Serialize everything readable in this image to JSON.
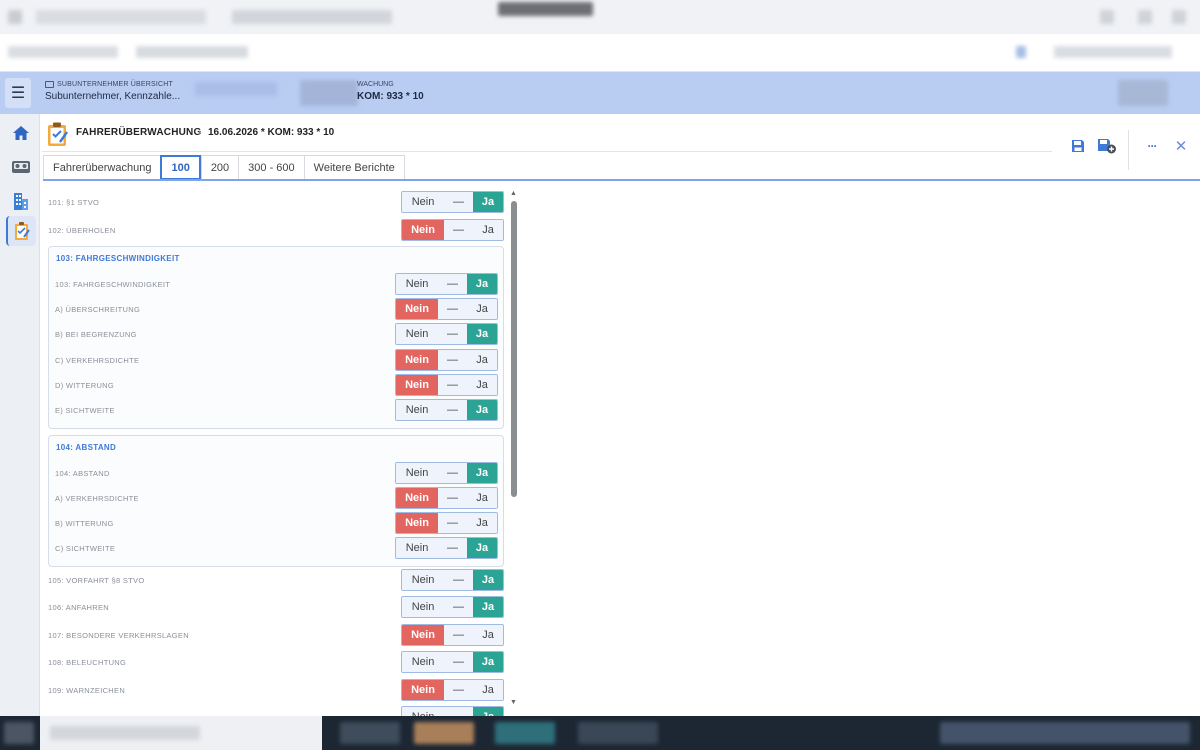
{
  "colors": {
    "nein": "#e26560",
    "ja": "#2ba496",
    "accent": "#3f7ad6",
    "header_bg": "#b9cdf3"
  },
  "app_header": {
    "breadcrumb_small": "SUBUNTERNEHMER ÜBERSICHT",
    "breadcrumb_big": "Subunternehmer, Kennzahle...",
    "context_small": "WACHUNG",
    "context_big": "KOM: 933 * 10"
  },
  "page": {
    "title": "FAHRERÜBERWACHUNG",
    "separator": "›",
    "subtitle": "16.06.2026 * KOM: 933 * 10"
  },
  "toolbar": {
    "icons": [
      "save-icon",
      "save-add-icon",
      "more-icon",
      "close-icon"
    ],
    "more_glyph": "···",
    "close_glyph": "✕"
  },
  "rail": {
    "icons": [
      "home-icon",
      "cassette-icon",
      "building-icon",
      "checklist-icon"
    ]
  },
  "tabs": [
    {
      "label": "Fahrerüberwachung",
      "active": false
    },
    {
      "label": "100",
      "active": true
    },
    {
      "label": "200",
      "active": false
    },
    {
      "label": "300 - 600",
      "active": false
    },
    {
      "label": "Weitere Berichte",
      "active": false
    }
  ],
  "segment": {
    "nein": "Nein",
    "dash": "—",
    "ja": "Ja"
  },
  "rows": [
    {
      "label": "101: §1 STVO",
      "value": "ja"
    },
    {
      "label": "102: ÜBERHOLEN",
      "value": "nein"
    }
  ],
  "groups": [
    {
      "title": "103: FAHRGESCHWINDIGKEIT",
      "rows": [
        {
          "label": "103: FAHRGESCHWINDIGKEIT",
          "value": "ja"
        },
        {
          "label": "A) ÜBERSCHREITUNG",
          "value": "nein"
        },
        {
          "label": "B) BEI BEGRENZUNG",
          "value": "ja"
        },
        {
          "label": "C) VERKEHRSDICHTE",
          "value": "nein"
        },
        {
          "label": "D) WITTERUNG",
          "value": "nein"
        },
        {
          "label": "E) SICHTWEITE",
          "value": "ja"
        }
      ]
    },
    {
      "title": "104: ABSTAND",
      "rows": [
        {
          "label": "104: ABSTAND",
          "value": "ja"
        },
        {
          "label": "A) VERKEHRSDICHTE",
          "value": "nein"
        },
        {
          "label": "B) WITTERUNG",
          "value": "nein"
        },
        {
          "label": "C) SICHTWEITE",
          "value": "ja"
        }
      ]
    }
  ],
  "rows_after": [
    {
      "label": "105: VORFAHRT §8 STVO",
      "value": "ja"
    },
    {
      "label": "106: ANFAHREN",
      "value": "ja"
    },
    {
      "label": "107: BESONDERE VERKEHRSLAGEN",
      "value": "nein"
    },
    {
      "label": "108: BELEUCHTUNG",
      "value": "ja"
    },
    {
      "label": "109: WARNZEICHEN",
      "value": "nein"
    },
    {
      "label": "",
      "value": "ja"
    }
  ]
}
